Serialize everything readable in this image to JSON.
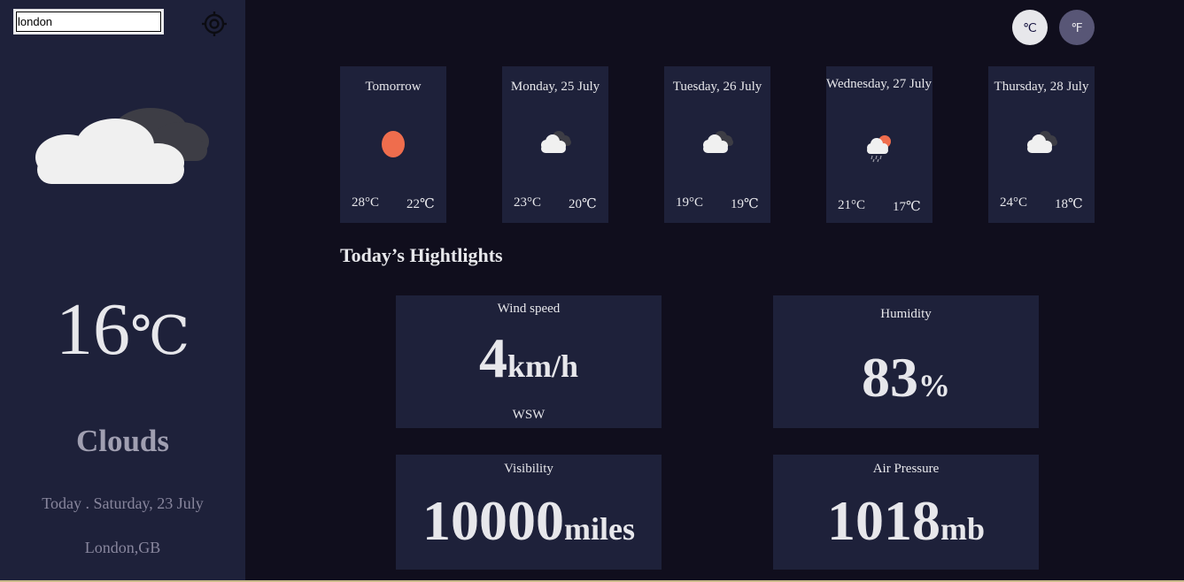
{
  "search": {
    "value": "london",
    "placeholder": ""
  },
  "current": {
    "temperature": "16",
    "unit": "℃",
    "condition": "Clouds",
    "date": "Today . Saturday, 23 July",
    "location": "London,GB",
    "icon": "broken-clouds-icon"
  },
  "units": {
    "celsius": "℃",
    "fahrenheit": "℉",
    "active": "celsius"
  },
  "forecast": [
    {
      "day": "Tomorrow",
      "max": "28°C",
      "min": "22℃",
      "icon": "clear-sun-icon"
    },
    {
      "day": "Monday, 25 July",
      "max": "23°C",
      "min": "20℃",
      "icon": "broken-clouds-icon"
    },
    {
      "day": "Tuesday, 26 July",
      "max": "19°C",
      "min": "19℃",
      "icon": "broken-clouds-icon"
    },
    {
      "day": "Wednesday, 27 July",
      "max": "21°C",
      "min": "17℃",
      "icon": "light-rain-icon"
    },
    {
      "day": "Thursday, 28 July",
      "max": "24°C",
      "min": "18℃",
      "icon": "broken-clouds-icon"
    }
  ],
  "highlights": {
    "title": "Today’s Hightlights",
    "wind": {
      "label": "Wind speed",
      "value": "4",
      "unit": "km/h",
      "direction": "WSW"
    },
    "humidity": {
      "label": "Humidity",
      "value": "83",
      "unit": "%"
    },
    "visibility": {
      "label": "Visibility",
      "value": "10000",
      "unit": "miles"
    },
    "pressure": {
      "label": "Air Pressure",
      "value": "1018",
      "unit": "mb"
    }
  },
  "colors": {
    "background": "#100e1d",
    "sidebar": "#1e213a",
    "card": "#1e213a",
    "sun": "#ef6d4d",
    "toggle_active": "#e7e7eb",
    "toggle_inactive": "#585676"
  }
}
